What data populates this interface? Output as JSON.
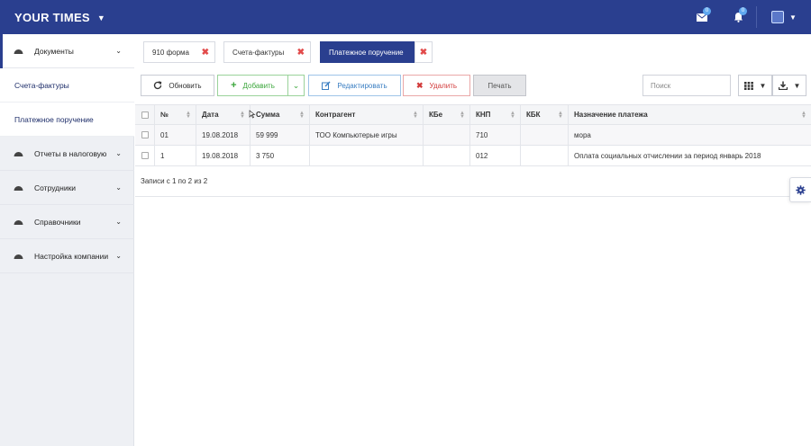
{
  "brand": {
    "title": "YOUR TIMES"
  },
  "topbar": {
    "mail_badge": "0",
    "bell_badge": "0"
  },
  "sidebar": {
    "documents": "Документы",
    "sub_items": [
      "Счета-фактуры",
      "Платежное поручение"
    ],
    "items": [
      "Отчеты в налоговую",
      "Сотрудники",
      "Справочники",
      "Настройка компании"
    ]
  },
  "tabs": [
    {
      "label": "910 форма"
    },
    {
      "label": "Счета-фактуры"
    },
    {
      "label": "Платежное поручение"
    }
  ],
  "toolbar": {
    "refresh": "Обновить",
    "add": "Добавить",
    "edit": "Редактировать",
    "delete": "Удалить",
    "print": "Печать",
    "search_placeholder": "Поиск"
  },
  "table": {
    "columns": [
      "№",
      "Дата",
      "Сумма",
      "Контрагент",
      "КБе",
      "КНП",
      "КБК",
      "Назначение платежа"
    ],
    "rows": [
      [
        "01",
        "19.08.2018",
        "59 999",
        "ТОО Компьютерые игры",
        "",
        "710",
        "",
        "мора"
      ],
      [
        "1",
        "19.08.2018",
        "3 750",
        "",
        "",
        "012",
        "",
        "Оплата социальных отчислении за период январь 2018"
      ]
    ],
    "footer": "Записи с 1 по 2 из 2"
  },
  "colors": {
    "primary": "#2a3f8f",
    "danger": "#e24b4b",
    "success": "#3aa63a",
    "info": "#3a7ec2"
  }
}
